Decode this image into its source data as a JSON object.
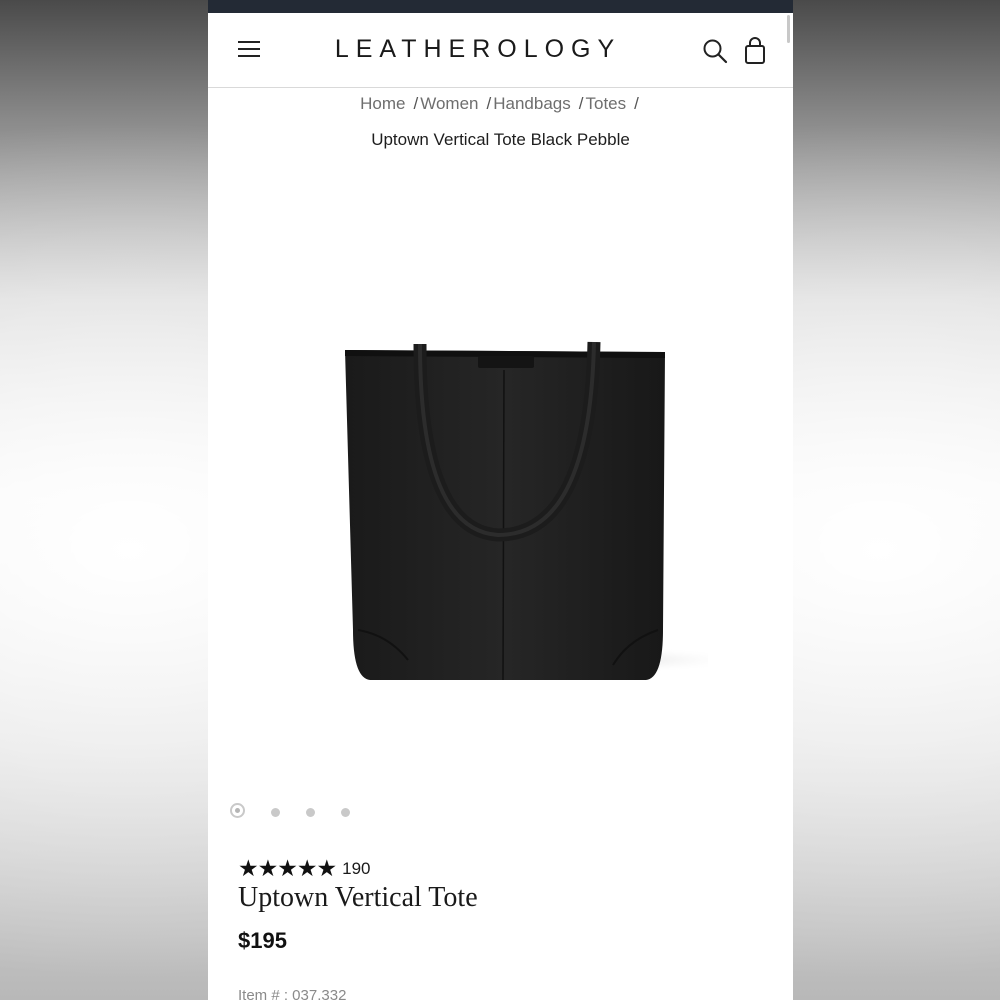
{
  "header": {
    "brand": "LEATHEROLOGY",
    "icons": [
      "menu-icon",
      "search-icon",
      "shopping-bag-icon"
    ]
  },
  "breadcrumb": {
    "items": [
      "Home",
      "Women",
      "Handbags",
      "Totes"
    ],
    "separator": "/",
    "current": "Uptown Vertical Tote Black Pebble"
  },
  "gallery": {
    "image_count": 4,
    "active_index": 0,
    "image": "black-pebble-leather-tote"
  },
  "product": {
    "stars": "★★★★★",
    "rating_value": 5,
    "review_count": "190",
    "title": "Uptown Vertical Tote",
    "price": "$195",
    "item_number": "Item # : 037.332"
  },
  "colors": {
    "status_bar": "#232a35",
    "text_primary": "#1a1a1a",
    "text_muted": "#6e6e6e",
    "dot": "#c9c9c9"
  }
}
